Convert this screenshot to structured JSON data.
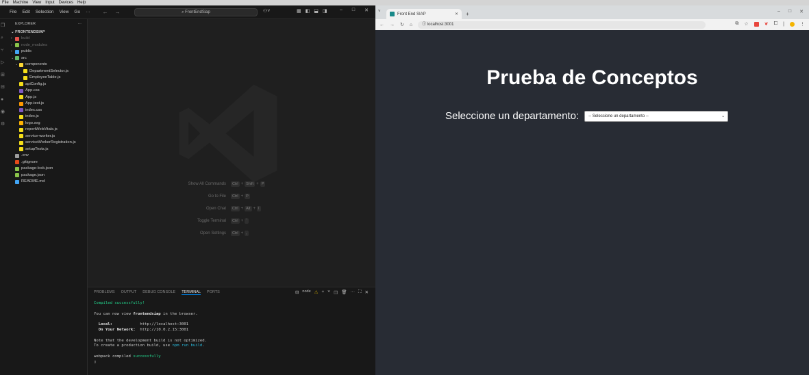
{
  "host_menu": [
    "File",
    "Machine",
    "View",
    "Input",
    "Devices",
    "Help"
  ],
  "vscode": {
    "menu": [
      "File",
      "Edit",
      "Selection",
      "View",
      "Go",
      "···"
    ],
    "search_text": "FrontEndSiap",
    "sidebar": {
      "explorer_title": "EXPLORER",
      "project": "FRONTENDSIAP",
      "tree": [
        {
          "label": "build",
          "indent": 1,
          "chev": ">",
          "color": "#e8534c",
          "dim": true
        },
        {
          "label": "node_modules",
          "indent": 1,
          "chev": ">",
          "color": "#8bc34a",
          "dim": true
        },
        {
          "label": "public",
          "indent": 1,
          "chev": ">",
          "color": "#42a5f5",
          "dim": false
        },
        {
          "label": "src",
          "indent": 1,
          "chev": "v",
          "color": "#66bb6a",
          "dim": false
        },
        {
          "label": "components",
          "indent": 2,
          "chev": "v",
          "color": "#fdd835",
          "dim": false
        },
        {
          "label": "DepartmentSelector.js",
          "indent": 3,
          "chev": "",
          "color": "#f5de19",
          "dim": false
        },
        {
          "label": "EmployeeTable.js",
          "indent": 3,
          "chev": "",
          "color": "#f5de19",
          "dim": false
        },
        {
          "label": "apiConfig.js",
          "indent": 2,
          "chev": "",
          "color": "#f5de19",
          "dim": false
        },
        {
          "label": "App.css",
          "indent": 2,
          "chev": "",
          "color": "#7e57c2",
          "dim": false
        },
        {
          "label": "App.js",
          "indent": 2,
          "chev": "",
          "color": "#f5de19",
          "dim": false
        },
        {
          "label": "App.test.js",
          "indent": 2,
          "chev": "",
          "color": "#ff9800",
          "dim": false
        },
        {
          "label": "index.css",
          "indent": 2,
          "chev": "",
          "color": "#7e57c2",
          "dim": false
        },
        {
          "label": "index.js",
          "indent": 2,
          "chev": "",
          "color": "#f5de19",
          "dim": false
        },
        {
          "label": "logo.svg",
          "indent": 2,
          "chev": "",
          "color": "#ffb300",
          "dim": false
        },
        {
          "label": "reportWebVitals.js",
          "indent": 2,
          "chev": "",
          "color": "#f5de19",
          "dim": false
        },
        {
          "label": "service-worker.js",
          "indent": 2,
          "chev": "",
          "color": "#f5de19",
          "dim": false
        },
        {
          "label": "serviceWorkerRegistration.js",
          "indent": 2,
          "chev": "",
          "color": "#f5de19",
          "dim": false
        },
        {
          "label": "setupTests.js",
          "indent": 2,
          "chev": "",
          "color": "#f5de19",
          "dim": false
        },
        {
          "label": ".env",
          "indent": 1,
          "chev": "",
          "color": "#9e9e9e",
          "dim": false
        },
        {
          "label": ".gitignore",
          "indent": 1,
          "chev": "",
          "color": "#e64a19",
          "dim": false
        },
        {
          "label": "package-lock.json",
          "indent": 1,
          "chev": "",
          "color": "#8bc34a",
          "dim": false
        },
        {
          "label": "package.json",
          "indent": 1,
          "chev": "",
          "color": "#8bc34a",
          "dim": false
        },
        {
          "label": "README.md",
          "indent": 1,
          "chev": "",
          "color": "#42a5f5",
          "dim": false
        }
      ]
    },
    "shortcuts": [
      {
        "label": "Show All Commands",
        "keys": [
          "Ctrl",
          "+",
          "Shift",
          "+",
          "P"
        ]
      },
      {
        "label": "Go to File",
        "keys": [
          "Ctrl",
          "+",
          "P"
        ]
      },
      {
        "label": "Open Chat",
        "keys": [
          "Ctrl",
          "+",
          "Alt",
          "+",
          "I"
        ]
      },
      {
        "label": "Toggle Terminal",
        "keys": [
          "Ctrl",
          "+",
          "`"
        ]
      },
      {
        "label": "Open Settings",
        "keys": [
          "Ctrl",
          "+",
          ","
        ]
      }
    ],
    "panel": {
      "tabs": [
        "PROBLEMS",
        "OUTPUT",
        "DEBUG CONSOLE",
        "TERMINAL",
        "PORTS"
      ],
      "active_tab": "TERMINAL",
      "terminal_name": "node"
    },
    "terminal": {
      "compiled": "Compiled successfully!",
      "view_prefix": "You can now view ",
      "app_name": "frontendsiap",
      "view_suffix": " in the browser.",
      "local_label": "Local:",
      "local_url": "http://localhost:3001",
      "network_label": "On Your Network:",
      "network_url": "http://10.0.2.15:3001",
      "note1": "Note that the development build is not optimized.",
      "note2_prefix": "To create a production build, use ",
      "note2_cmd": "npm run build",
      "note2_suffix": ".",
      "webpack_prefix": "webpack compiled ",
      "webpack_status": "successfully"
    }
  },
  "browser": {
    "tab_title": "Front End SIAP",
    "url": "localhost:3001",
    "page": {
      "heading": "Prueba de Conceptos",
      "select_label": "Seleccione un departamento:",
      "select_value": "-- Seleccione un departamento --"
    }
  }
}
